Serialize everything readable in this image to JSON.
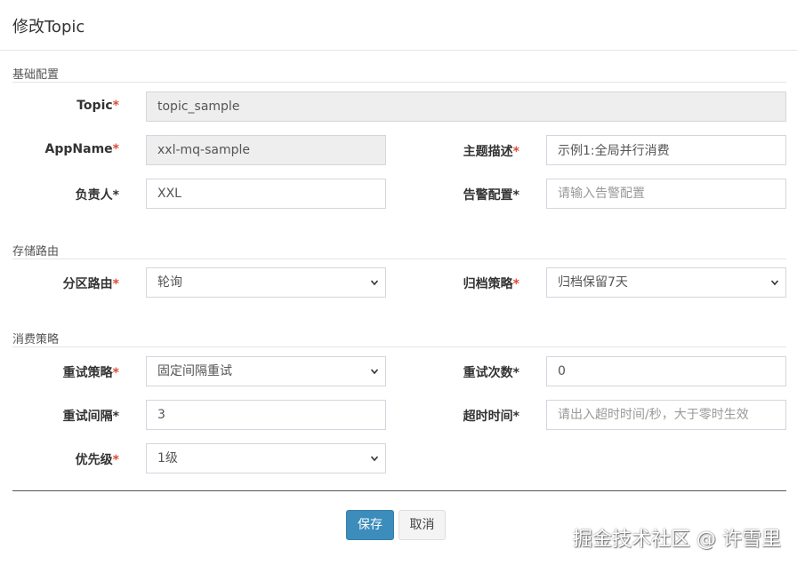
{
  "modal": {
    "title": "修改Topic"
  },
  "sections": {
    "basic": "基础配置",
    "storage": "存储路由",
    "consume": "消费策略"
  },
  "fields": {
    "topic": {
      "label": "Topic",
      "value": "topic_sample"
    },
    "appname": {
      "label": "AppName",
      "value": "xxl-mq-sample"
    },
    "desc": {
      "label": "主题描述",
      "value": "示例1:全局并行消费"
    },
    "owner": {
      "label": "负责人",
      "value": "XXL"
    },
    "alarm": {
      "label": "告警配置",
      "value": "",
      "placeholder": "请输入告警配置"
    },
    "partition": {
      "label": "分区路由",
      "value": "轮询"
    },
    "archive": {
      "label": "归档策略",
      "value": "归档保留7天"
    },
    "retry_strategy": {
      "label": "重试策略",
      "value": "固定间隔重试"
    },
    "retry_count": {
      "label": "重试次数",
      "value": "0"
    },
    "retry_interval": {
      "label": "重试间隔",
      "value": "3"
    },
    "timeout": {
      "label": "超时时间",
      "value": "",
      "placeholder": "请出入超时时间/秒，大于零时生效"
    },
    "priority": {
      "label": "优先级",
      "value": "1级"
    }
  },
  "buttons": {
    "save": "保存",
    "cancel": "取消"
  },
  "watermark": "掘金技术社区 @ 许雪里",
  "colors": {
    "required": "#dd4b39",
    "primary": "#3c8dbc",
    "disabled_bg": "#eeeeee"
  }
}
